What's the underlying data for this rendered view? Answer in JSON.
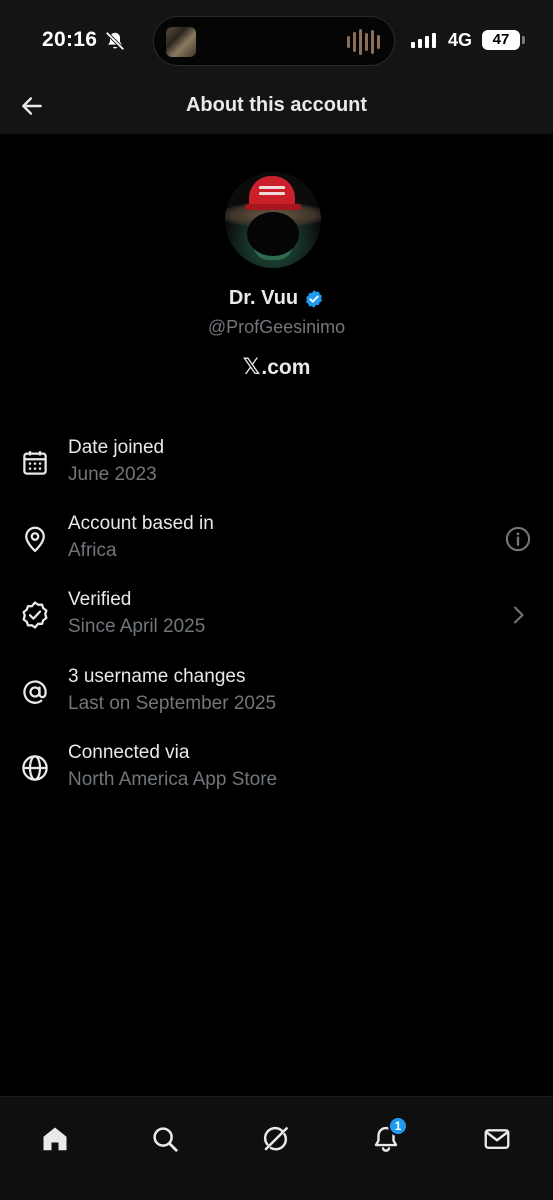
{
  "status_bar": {
    "time": "20:16",
    "network": "4G",
    "battery": "47"
  },
  "header": {
    "title": "About this account"
  },
  "profile": {
    "display_name": "Dr. Vuu",
    "handle": "@ProfGeesinimo",
    "site": ".com",
    "site_mark": "𝕏"
  },
  "info_rows": [
    {
      "icon": "calendar-icon",
      "title": "Date joined",
      "subtitle": "June 2023"
    },
    {
      "icon": "location-pin-icon",
      "title": "Account based in",
      "subtitle": "Africa",
      "trailing": "info-icon"
    },
    {
      "icon": "verified-seal-icon",
      "title": "Verified",
      "subtitle": "Since April 2025",
      "trailing": "chevron-right-icon"
    },
    {
      "icon": "at-sign-icon",
      "title": "3 username changes",
      "subtitle": "Last on September 2025"
    },
    {
      "icon": "globe-icon",
      "title": "Connected via",
      "subtitle": "North America App Store"
    }
  ],
  "bottom_nav": {
    "items": [
      "home-icon",
      "search-icon",
      "grok-icon",
      "notifications-icon",
      "messages-icon"
    ],
    "notifications_count": "1"
  },
  "colors": {
    "background": "#000000",
    "bar_background": "#141414",
    "text_primary": "#e7e9ea",
    "text_secondary": "#71767b",
    "accent": "#1d9bf0"
  }
}
